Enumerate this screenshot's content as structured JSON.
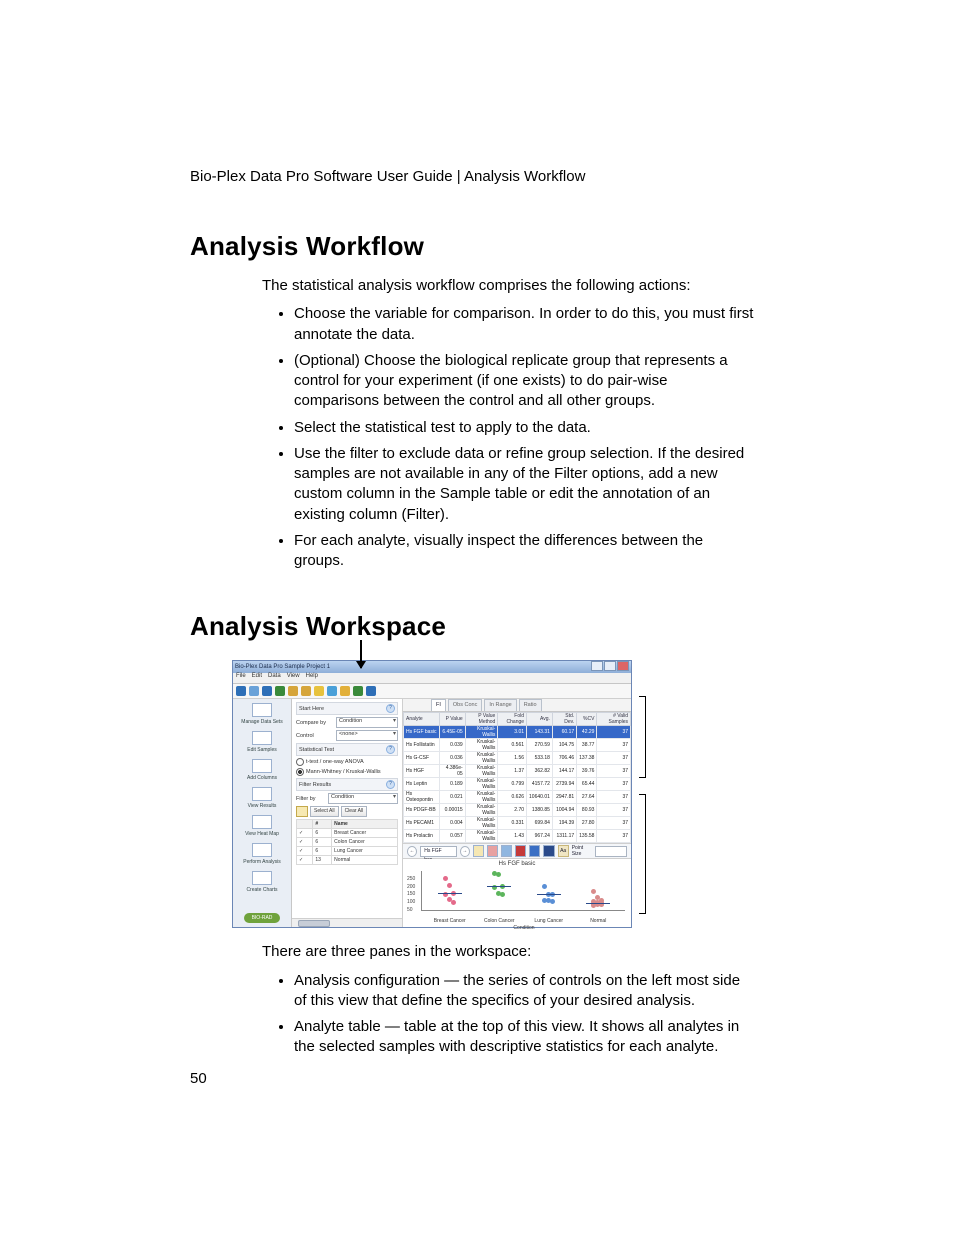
{
  "header": "Bio-Plex Data Pro Software User Guide | Analysis Workflow",
  "h1a": "Analysis Workflow",
  "intro": "The statistical analysis workflow comprises the following actions:",
  "bullets1": [
    "Choose the variable for comparison. In order to do this, you must first annotate the data.",
    "(Optional) Choose the biological replicate group that represents a control for your experiment (if one exists) to do pair-wise comparisons between the control and all other groups.",
    "Select the statistical test to apply to the data.",
    "Use the filter to exclude data or refine group selection. If the desired samples are not available in any of the Filter options, add a new custom column in the Sample table or edit the annotation of an existing column (Filter).",
    "For each analyte, visually inspect the differences between the groups."
  ],
  "h1b": "Analysis Workspace",
  "after": "There are three panes in the workspace:",
  "bullets2": [
    "Analysis configuration — the series of controls on the left most side of this view that define the specifics of your desired analysis.",
    "Analyte table — table at the top of this view. It shows all analytes in the selected samples with descriptive statistics for each analyte."
  ],
  "pagenum": "50",
  "shot": {
    "title": "Bio-Plex Data Pro Sample Project 1",
    "menus": [
      "File",
      "Edit",
      "Data",
      "View",
      "Help"
    ],
    "toolbar_icons": [
      "#2e6fb7",
      "#6aa2d8",
      "#2e6fb7",
      "#3a8a3a",
      "#d6a53a",
      "#d6a53a",
      "#e7c23d",
      "#4aa0d8",
      "#e2b03a",
      "#3a8a3a",
      "#2e6fb7"
    ],
    "tabs": [
      "FI",
      "Obs Conc",
      "In Range",
      "Ratio"
    ],
    "nav": [
      {
        "label": "Manage Data Sets"
      },
      {
        "label": "Edit Samples"
      },
      {
        "label": "Add Columns"
      },
      {
        "label": "View Results"
      },
      {
        "label": "View Heat Map"
      },
      {
        "label": "Perform Analysis"
      },
      {
        "label": "Create Charts"
      }
    ],
    "logo": "BIO-RAD",
    "cfg": {
      "p1": "Start Here",
      "compare_by_lbl": "Compare by",
      "compare_by": "Condition",
      "control_lbl": "Control",
      "control": "<none>",
      "p2": "Statistical Test",
      "opt1": "t-test / one-way ANOVA",
      "opt2": "Mann-Whitney / Kruskal-Wallis",
      "p3": "Filter Results",
      "filter_by_lbl": "Filter by",
      "filter_by": "Condition",
      "btn_sel": "Select All",
      "btn_clr": "Clear All",
      "flt_head": [
        "",
        "#",
        "Name"
      ],
      "flt_rows": [
        [
          "✓",
          "6",
          "Breast Cancer"
        ],
        [
          "✓",
          "6",
          "Colon Cancer"
        ],
        [
          "✓",
          "6",
          "Lung Cancer"
        ],
        [
          "✓",
          "13",
          "Normal"
        ]
      ]
    },
    "table": {
      "cols": [
        "Analyte",
        "P Value",
        "P Value Method",
        "Fold Change",
        "Avg.",
        "Std. Dev.",
        "%CV",
        "# Valid Samples"
      ],
      "rows": [
        [
          "Hs FGF basic",
          "6.45E-05",
          "Kruskal-Wallis",
          "3.01",
          "143.31",
          "60.17",
          "42.29",
          "37"
        ],
        [
          "Hs Follistatin",
          "0.039",
          "Kruskal-Wallis",
          "0.561",
          "270.59",
          "104.75",
          "38.77",
          "37"
        ],
        [
          "Hs G-CSF",
          "0.036",
          "Kruskal-Wallis",
          "1.56",
          "533.18",
          "706.46",
          "137.38",
          "37"
        ],
        [
          "Hs HGF",
          "4.386e-05",
          "Kruskal-Wallis",
          "1.37",
          "362.82",
          "144.17",
          "39.76",
          "37"
        ],
        [
          "Hs Leptin",
          "0.189",
          "Kruskal-Wallis",
          "0.799",
          "4157.72",
          "2739.94",
          "65.44",
          "37"
        ],
        [
          "Hs Osteopontin",
          "0.021",
          "Kruskal-Wallis",
          "0.626",
          "10640.01",
          "2947.81",
          "27.64",
          "37"
        ],
        [
          "Hs PDGF-BB",
          "0.00015",
          "Kruskal-Wallis",
          "2.70",
          "1380.85",
          "1004.94",
          "80.93",
          "37"
        ],
        [
          "Hs PECAM1",
          "0.004",
          "Kruskal-Wallis",
          "0.331",
          "699.84",
          "194.39",
          "27.80",
          "37"
        ],
        [
          "Hs Prolactin",
          "0.057",
          "Kruskal-Wallis",
          "1.43",
          "967.24",
          "1311.17",
          "135.58",
          "37"
        ]
      ]
    },
    "chartbar": {
      "sel": "Hs FGF bas...",
      "label": "Point Size"
    },
    "chart_data": {
      "type": "scatter",
      "title": "Hs FGF basic",
      "xlabel": "Condition",
      "categories": [
        "Breast Cancer",
        "Colon Cancer",
        "Lung Cancer",
        "Normal"
      ],
      "yticks": [
        50,
        100,
        150,
        200,
        250
      ],
      "ylim": [
        40,
        300
      ],
      "series": [
        {
          "name": "Breast Cancer",
          "color": "#e46a8a",
          "values": [
            255,
            210,
            160,
            150,
            120,
            100
          ]
        },
        {
          "name": "Colon Cancer",
          "color": "#5cb55c",
          "values": [
            290,
            280,
            205,
            200,
            160,
            155
          ]
        },
        {
          "name": "Lung Cancer",
          "color": "#5a8fd6",
          "values": [
            205,
            155,
            150,
            115,
            110,
            105
          ]
        },
        {
          "name": "Normal",
          "color": "#d98b8b",
          "values": [
            170,
            130,
            115,
            105,
            100,
            100,
            95,
            95,
            90,
            90,
            85,
            85,
            80
          ]
        }
      ]
    }
  }
}
